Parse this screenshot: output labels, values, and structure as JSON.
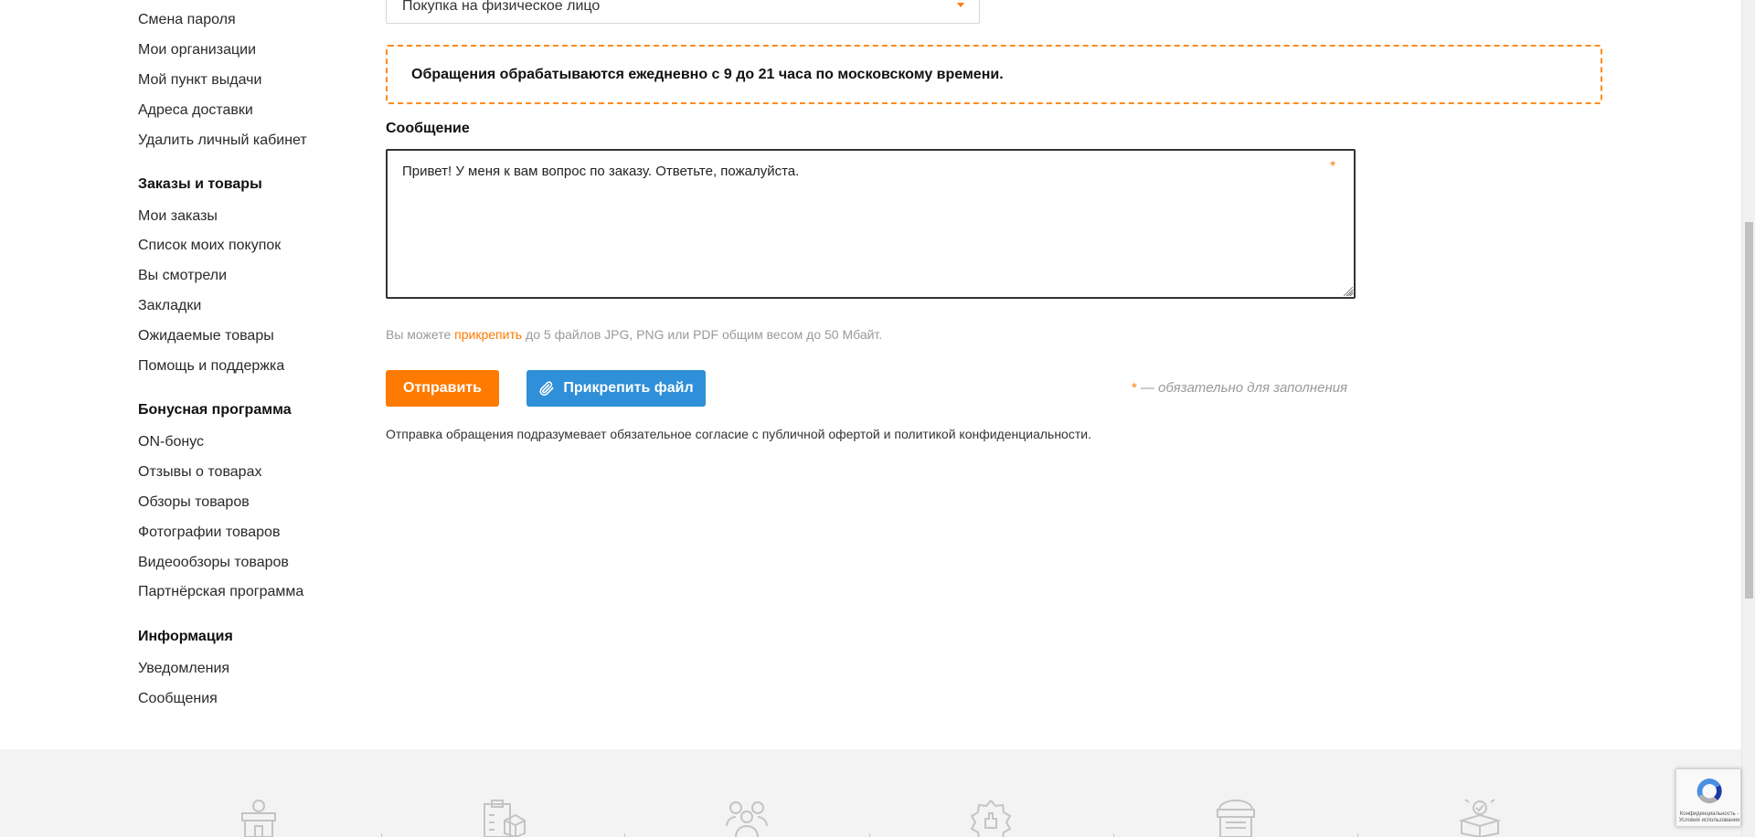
{
  "sidebar": {
    "profile_links": [
      "Смена пароля",
      "Мои организации",
      "Мой пункт выдачи",
      "Адреса доставки",
      "Удалить личный кабинет"
    ],
    "orders": {
      "heading": "Заказы и товары",
      "items": [
        "Мои заказы",
        "Список моих покупок",
        "Вы смотрели",
        "Закладки",
        "Ожидаемые товары",
        "Помощь и поддержка"
      ]
    },
    "bonus": {
      "heading": "Бонусная программа",
      "items": [
        "ON-бонус",
        "Отзывы о товарах",
        "Обзоры товаров",
        "Фотографии товаров",
        "Видеообзоры товаров",
        "Партнёрская программа"
      ]
    },
    "info": {
      "heading": "Информация",
      "items": [
        "Уведомления",
        "Сообщения"
      ]
    }
  },
  "form": {
    "topic_select_value": "Покупка на физическое лицо",
    "notice": "Обращения обрабатываются ежедневно с 9 до 21 часа по московскому времени.",
    "message_label": "Сообщение",
    "message_value": "Привет! У меня к вам вопрос по заказу. Ответьте, пожалуйста.",
    "required_star": "*",
    "hint_before": "Вы можете ",
    "hint_link": "прикрепить",
    "hint_after": " до 5 файлов JPG, PNG или PDF общим весом до 50 Мбайт.",
    "send_button": "Отправить",
    "attach_button": "Прикрепить файл",
    "required_note": "— обязательно для заполнения",
    "consent": "Отправка обращения подразумевает обязательное согласие с публичной офертой и политикой конфиденциальности."
  },
  "recaptcha": {
    "text": "Конфиденциальность - Условия использования"
  },
  "colors": {
    "accent_orange": "#ff7a00",
    "attach_blue": "#2f8fd8"
  }
}
